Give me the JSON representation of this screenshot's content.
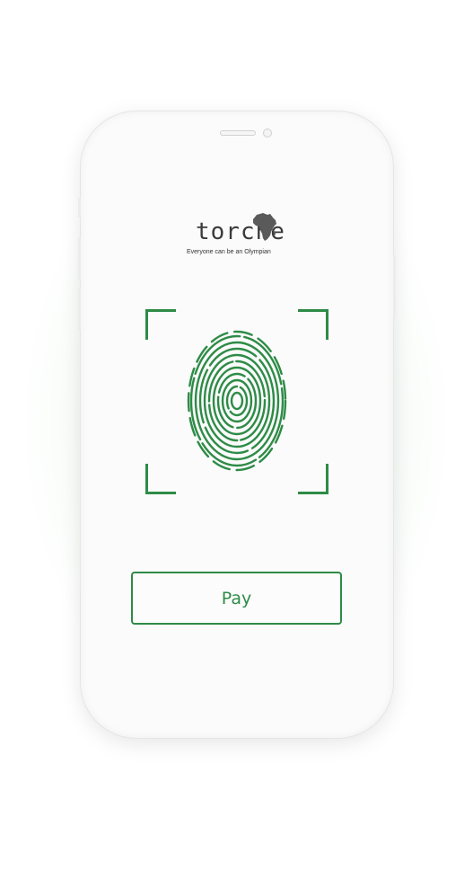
{
  "app": {
    "brand": "torche",
    "tagline": "Everyone can be an Olympian"
  },
  "scanner": {
    "icon": "fingerprint-icon",
    "accent_color": "#2e8b47"
  },
  "actions": {
    "pay_label": "Pay"
  }
}
